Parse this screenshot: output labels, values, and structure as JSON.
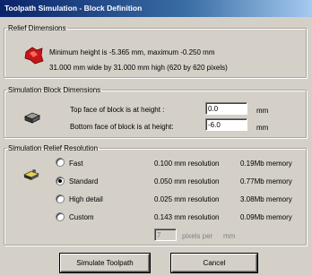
{
  "window": {
    "title": "Toolpath Simulation - Block Definition"
  },
  "relief": {
    "legend": "Relief Dimensions",
    "line1": "Minimum height is -5.365 mm, maximum -0.250 mm",
    "line2": "31.000 mm wide by 31.000 mm high (620 by 620 pixels)"
  },
  "block": {
    "legend": "Simulation Block Dimensions",
    "top_label": "Top face of block is at height :",
    "top_value": "0.0",
    "top_unit": "mm",
    "bottom_label": "Bottom face of block is at height:",
    "bottom_value": "-6.0",
    "bottom_unit": "mm"
  },
  "resolution": {
    "legend": "Simulation Relief Resolution",
    "options": [
      {
        "label": "Fast",
        "res": "0.100 mm resolution",
        "mem": "0.19Mb memory"
      },
      {
        "label": "Standard",
        "res": "0.050 mm resolution",
        "mem": "0.77Mb memory"
      },
      {
        "label": "High detail",
        "res": "0.025 mm resolution",
        "mem": "3.08Mb memory"
      },
      {
        "label": "Custom",
        "res": "0.143 mm resolution",
        "mem": "0.09Mb memory"
      }
    ],
    "selected": "Standard",
    "custom_value": "7",
    "custom_unit": "pixels per",
    "custom_unit2": "mm"
  },
  "buttons": {
    "simulate": "Simulate Toolpath",
    "cancel": "Cancel"
  },
  "colors": {
    "title_start": "#0a246a",
    "title_end": "#a6caf0",
    "relief_icon": "#c41818"
  }
}
